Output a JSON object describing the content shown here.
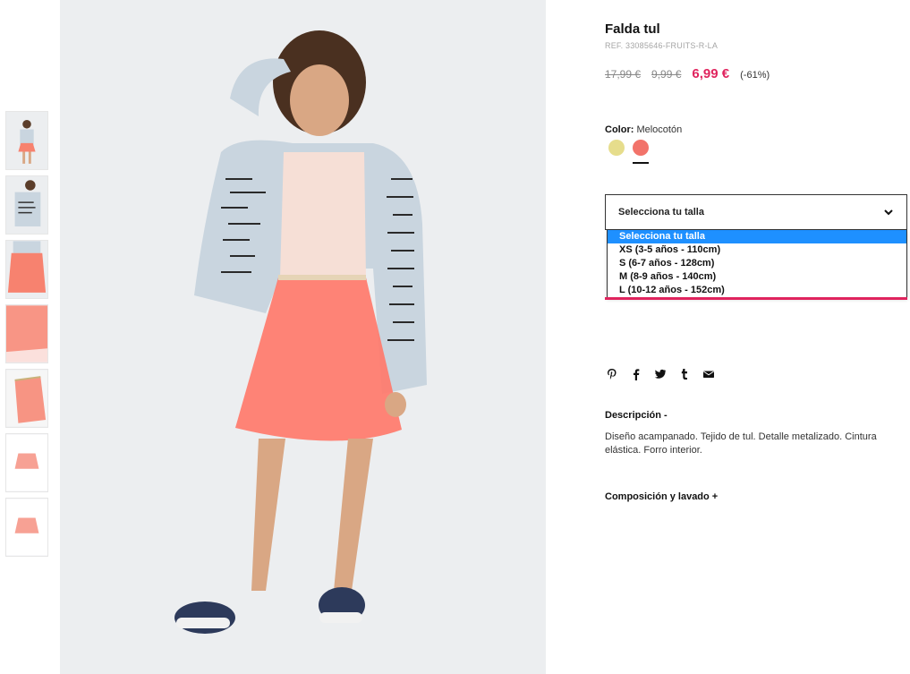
{
  "product": {
    "title": "Falda tul",
    "ref": "REF. 33085646-FRUITS-R-LA",
    "price_original": "17,99 €",
    "price_previous": "9,99 €",
    "price_current": "6,99 €",
    "discount": "(-61%)"
  },
  "color": {
    "label": "Color:",
    "value": "Melocotón",
    "swatches": [
      {
        "name": "amarillo",
        "hex": "#e6dd8c"
      },
      {
        "name": "melocoton",
        "hex": "#f2736a",
        "active": true
      }
    ]
  },
  "size": {
    "select_label": "Selecciona tu talla",
    "options": [
      "Selecciona tu talla",
      "XS (3-5 años - 110cm)",
      "S (6-7 años - 128cm)",
      "M (8-9 años - 140cm)",
      "L (10-12 años - 152cm)"
    ],
    "highlighted_index": 0
  },
  "share": [
    "pinterest-icon",
    "facebook-icon",
    "twitter-icon",
    "tumblr-icon",
    "email-icon"
  ],
  "description": {
    "title": "Descripción -",
    "text": "Diseño acampanado. Tejido de tul. Detalle metalizado. Cintura elástica. Forro interior."
  },
  "composition": {
    "title": "Composición y lavado +"
  },
  "colors": {
    "accent": "#e0245e",
    "select_highlight": "#1e90ff",
    "background_photo": "#eceef0"
  }
}
